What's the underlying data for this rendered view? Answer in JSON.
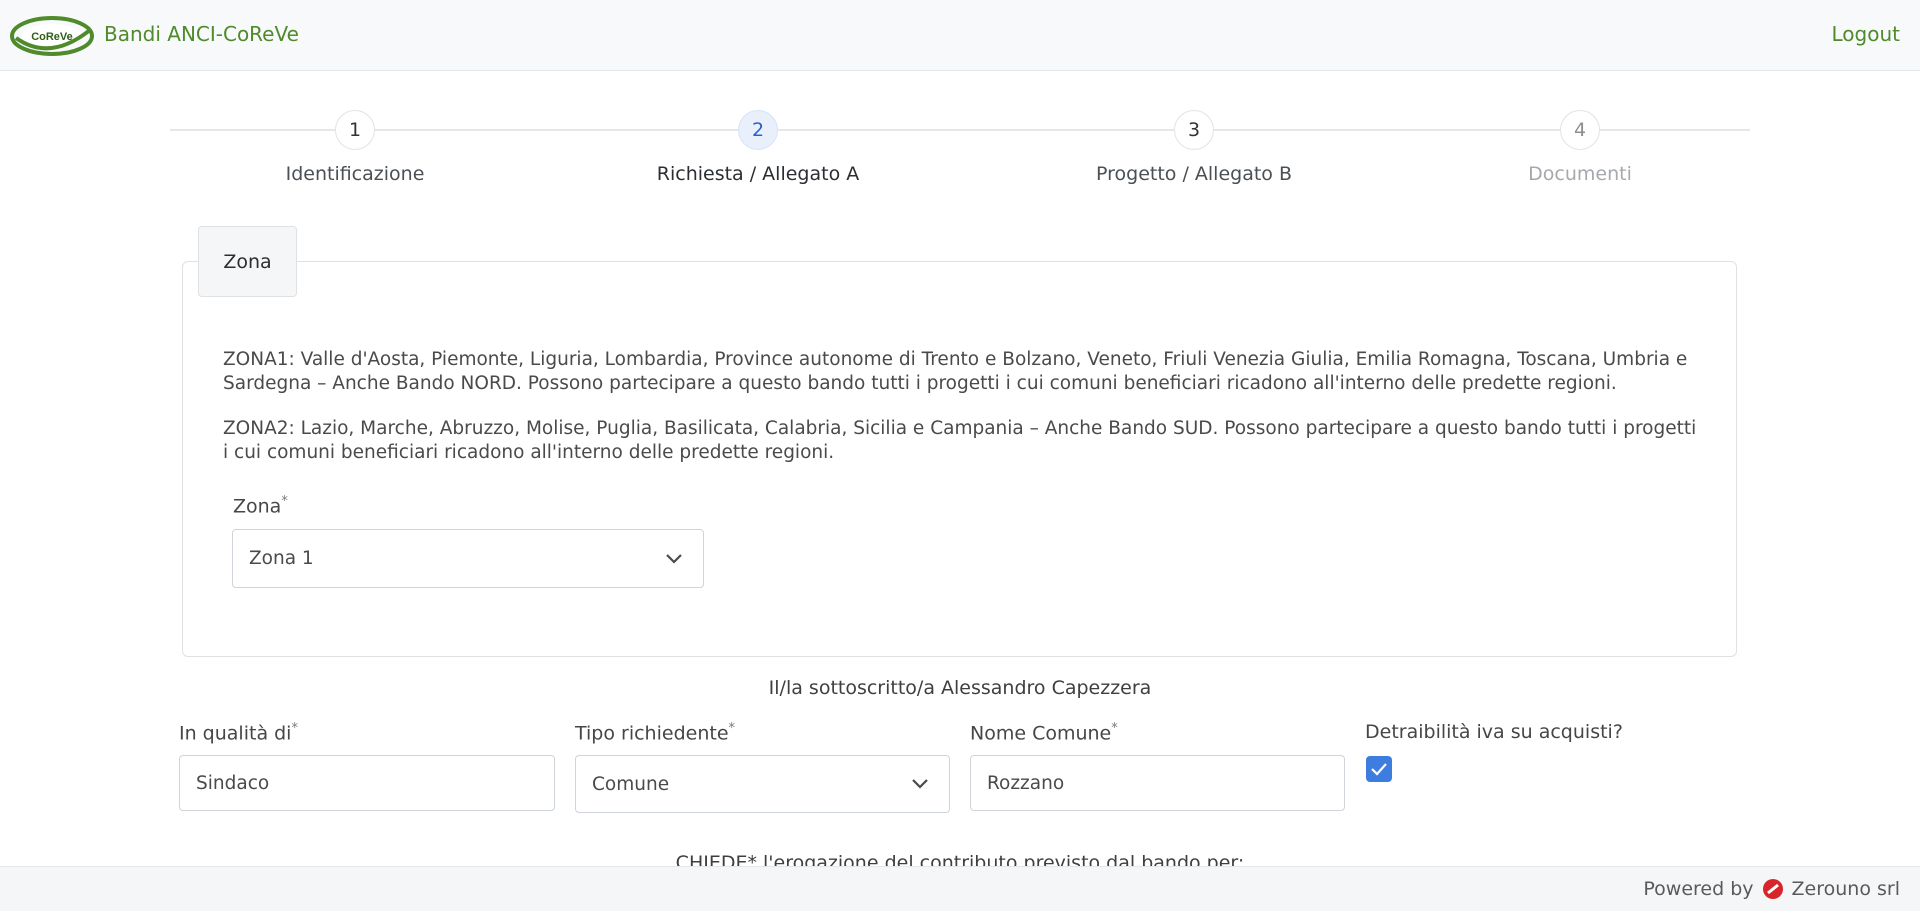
{
  "header": {
    "logo_text": "CoReVe",
    "brand": "Bandi ANCI-CoReVe",
    "logout": "Logout"
  },
  "stepper": {
    "steps": [
      {
        "number": "1",
        "label": "Identificazione"
      },
      {
        "number": "2",
        "label": "Richiesta / Allegato A"
      },
      {
        "number": "3",
        "label": "Progetto / Allegato B"
      },
      {
        "number": "4",
        "label": "Documenti"
      }
    ]
  },
  "zona_panel": {
    "tab": "Zona",
    "zona1_text": "ZONA1: Valle d'Aosta, Piemonte, Liguria, Lombardia, Province autonome di Trento e Bolzano, Veneto, Friuli Venezia Giulia, Emilia Romagna, Toscana, Umbria e Sardegna – Anche Bando NORD. Possono partecipare a questo bando tutti i progetti i cui comuni beneficiari ricadono all'interno delle predette regioni.",
    "zona2_text": "ZONA2: Lazio, Marche, Abruzzo, Molise, Puglia, Basilicata, Calabria, Sicilia e Campania – Anche Bando SUD. Possono partecipare a questo bando tutti i progetti i cui comuni beneficiari ricadono all'interno delle predette regioni.",
    "zona_label": "Zona",
    "zona_value": "Zona 1"
  },
  "form": {
    "sottoscritto": "Il/la sottoscritto/a Alessandro Capezzera",
    "qualita_label": "In qualità di",
    "qualita_value": "Sindaco",
    "tipo_label": "Tipo richiedente",
    "tipo_value": "Comune",
    "comune_label": "Nome Comune",
    "comune_value": "Rozzano",
    "iva_label": "Detraibilità iva su acquisti?",
    "iva_checked": true,
    "required_mark": "*",
    "chiede": "CHIEDE* l'erogazione del contributo previsto dal bando per:"
  },
  "footer": {
    "powered_by": "Powered by",
    "company": "Zerouno srl"
  },
  "colors": {
    "brand_green": "#4f8a2b",
    "active_step": "#2a5fd0",
    "checkbox": "#3d7de0",
    "zerouno_red": "#d7262b"
  }
}
